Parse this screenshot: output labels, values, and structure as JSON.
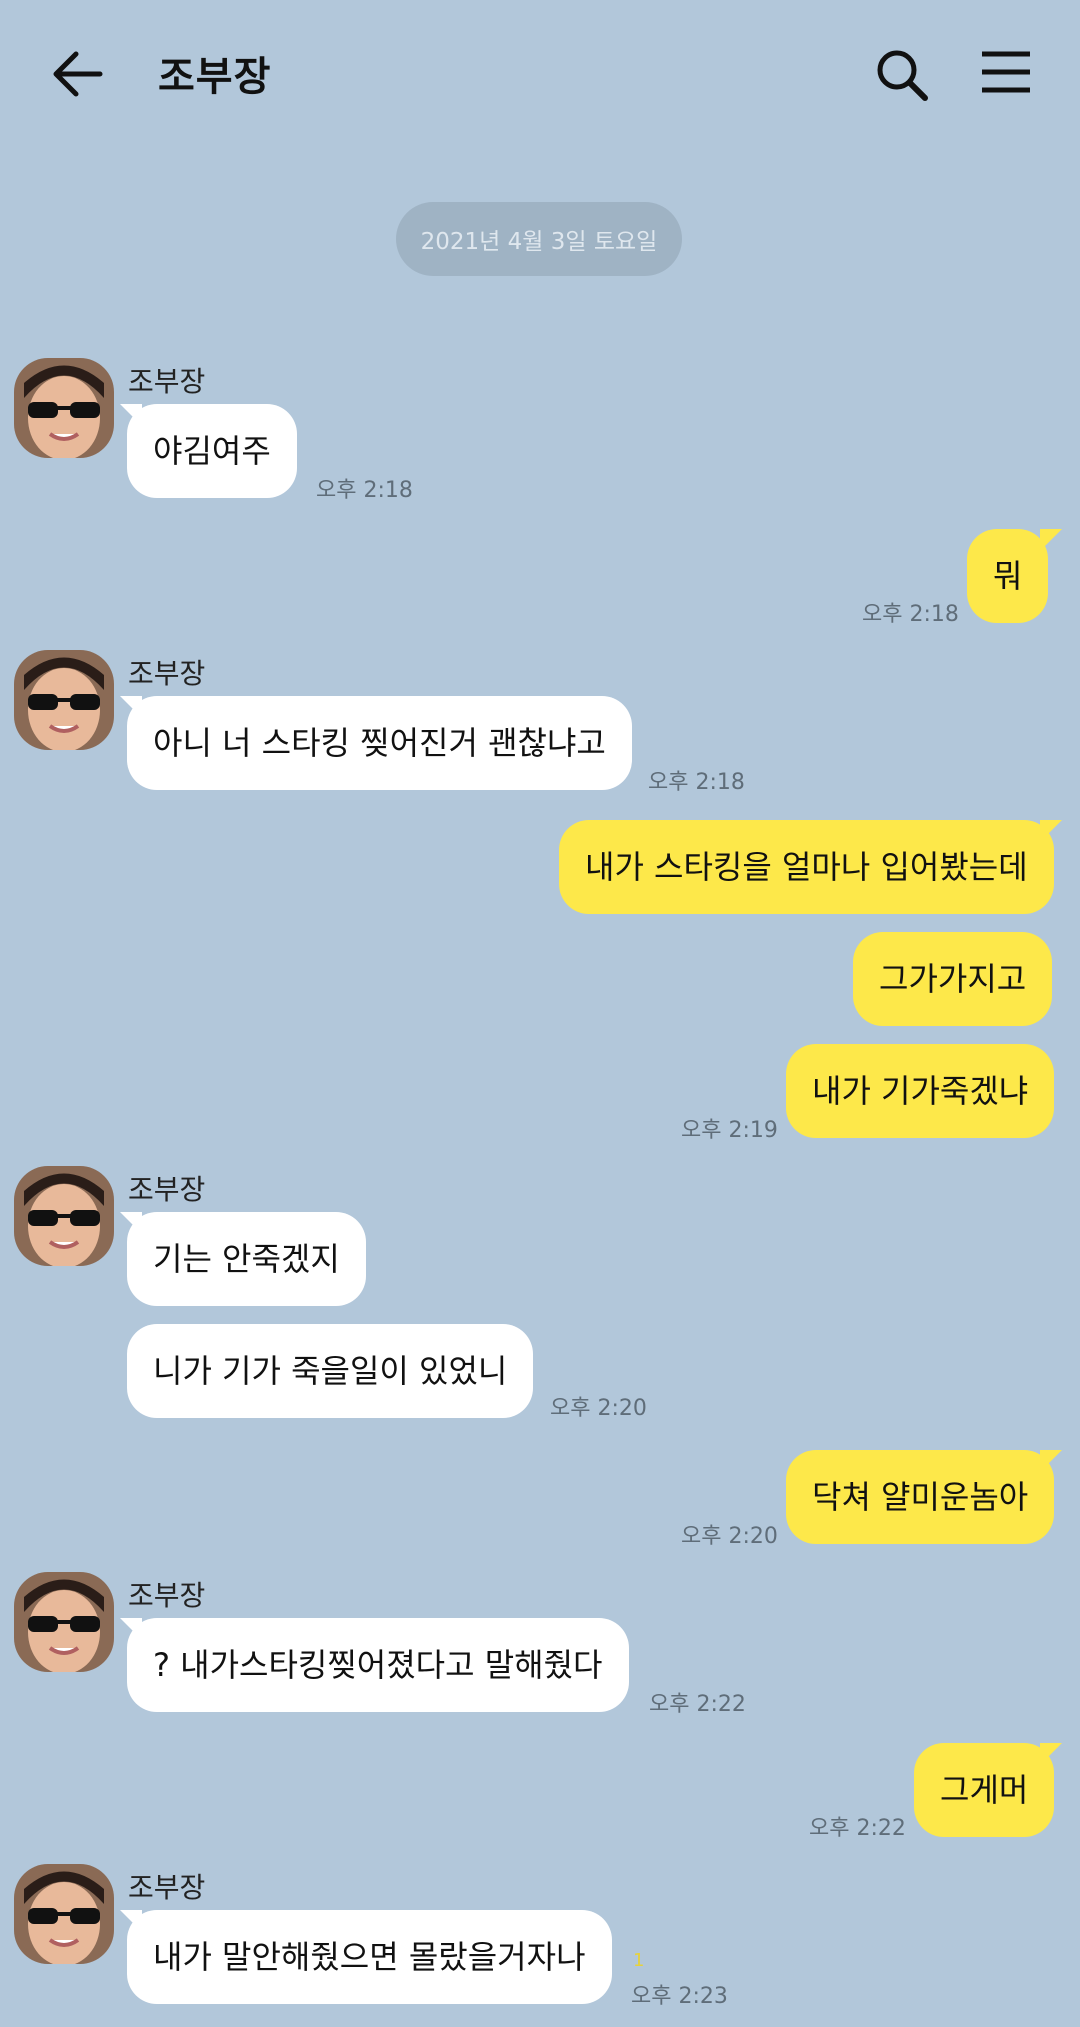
{
  "header": {
    "title": "조부장",
    "back_icon": "arrow-left-icon",
    "search_icon": "search-icon",
    "menu_icon": "hamburger-menu-icon"
  },
  "date_divider": "2021년 4월 3일 토요일",
  "colors": {
    "background": "#b2c7da",
    "incoming_bubble": "#ffffff",
    "outgoing_bubble": "#fde84a",
    "date_pill": "#9fb3c4"
  },
  "messages": [
    {
      "sender": "조부장",
      "text": "야김여주",
      "time": "오후 2:18"
    },
    {
      "text": "뭐",
      "time": "오후 2:18"
    },
    {
      "sender": "조부장",
      "text": "아니 너 스타킹 찢어진거 괜찮냐고",
      "time": "오후 2:18"
    },
    {
      "text": "내가 스타킹을 얼마나 입어봤는데"
    },
    {
      "text": "그가가지고"
    },
    {
      "text": "내가 기가죽겠냐",
      "time": "오후 2:19"
    },
    {
      "sender": "조부장",
      "text": "기는 안죽겠지"
    },
    {
      "text": "니가 기가 죽을일이 있었니",
      "time": "오후 2:20"
    },
    {
      "text": "닥쳐 얄미운놈아",
      "time": "오후 2:20"
    },
    {
      "sender": "조부장",
      "text": "? 내가스타킹찢어졌다고 말해줬다",
      "time": "오후 2:22"
    },
    {
      "text": "그게머",
      "time": "오후 2:22"
    },
    {
      "sender": "조부장",
      "text": "내가 말안해줬으면 몰랐을거자나",
      "time": "오후 2:23",
      "unread": "1"
    }
  ]
}
